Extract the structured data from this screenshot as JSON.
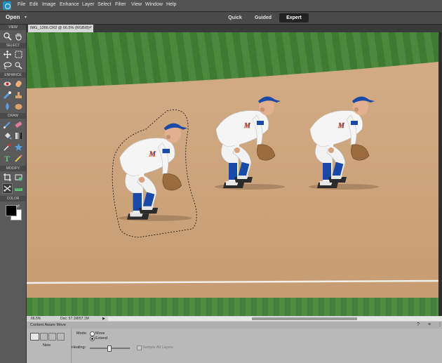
{
  "menubar": {
    "items": [
      "File",
      "Edit",
      "Image",
      "Enhance",
      "Layer",
      "Select",
      "Filter",
      "View",
      "Window",
      "Help"
    ]
  },
  "bar2": {
    "open_label": "Open",
    "modes": {
      "quick": "Quick",
      "guided": "Guided",
      "expert": "Expert"
    },
    "active_mode": "Expert"
  },
  "document": {
    "tab_title": "IMG_1366.CR2 @ 66.5% (RGB/8) *",
    "close_glyph": "×"
  },
  "toolbox": {
    "sections": {
      "view": "VIEW",
      "select": "SELECT",
      "enhance": "ENHANCE",
      "draw": "DRAW",
      "modify": "MODIFY",
      "color": "COLOR"
    }
  },
  "status": {
    "zoom": "66.5%",
    "doc": "Doc: 57.1M/57.1M"
  },
  "options": {
    "tool_name": "Content Aware Move",
    "new_label": "New",
    "mode_label": "Mode:",
    "mode_move": "Move",
    "mode_extend": "Extend",
    "mode_selected": "Extend",
    "healing_label": "Healing:",
    "sample_all": "Sample All Layers"
  },
  "colors": {
    "accent": "#1d8fc4",
    "foreground": "#000000",
    "background": "#ffffff",
    "jersey_blue": "#1a4aa8"
  }
}
